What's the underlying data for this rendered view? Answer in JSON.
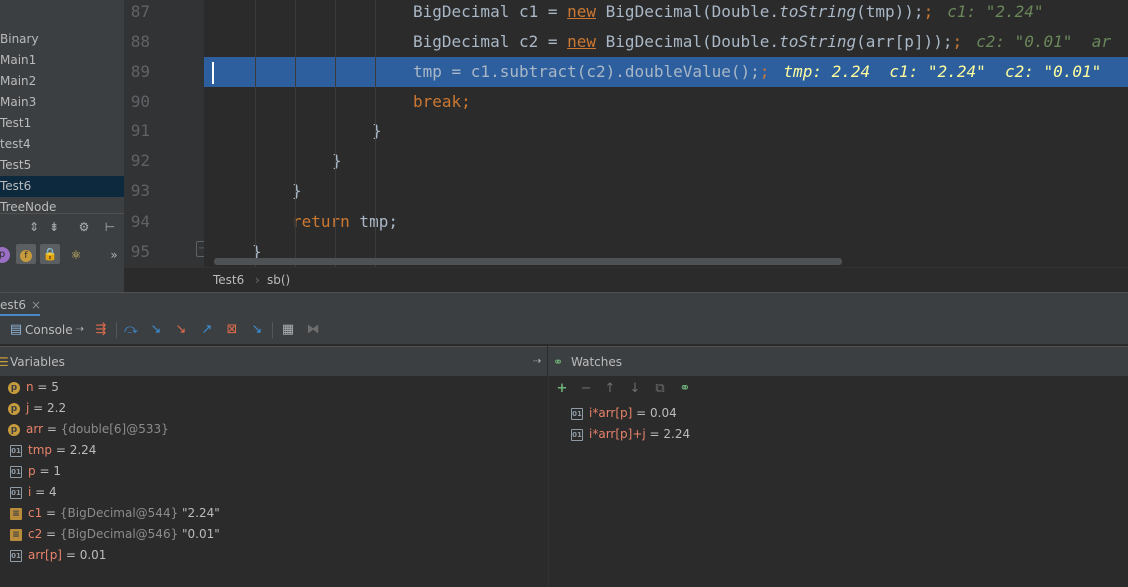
{
  "project_tree": {
    "items": [
      "Binary",
      "Main1",
      "Main2",
      "Main3",
      "Test1",
      "test4",
      "Test5",
      "Test6",
      "TreeNode"
    ],
    "selected": "Test6"
  },
  "editor": {
    "line_numbers": [
      "87",
      "88",
      "89",
      "90",
      "91",
      "92",
      "93",
      "94",
      "95"
    ],
    "highlighted_line": "89",
    "lines": {
      "l87": {
        "a": "BigDecimal c1 = ",
        "b": "new",
        "c": " BigDecimal(Double.",
        "d": "toString",
        "e": "(tmp));",
        "hint": "c1: \"2.24\""
      },
      "l88": {
        "a": "BigDecimal c2 = ",
        "b": "new",
        "c": " BigDecimal(Double.",
        "d": "toString",
        "e": "(arr[p]));",
        "hint": "c2: \"0.01\"  ar"
      },
      "l89": {
        "code": "tmp = c1.subtract(c2).doubleValue();",
        "hint": "tmp: 2.24  c1: \"2.24\"  c2: \"0.01\""
      },
      "l90": {
        "kw": "break",
        "tail": ";"
      },
      "l91": {
        "text": "}"
      },
      "l92": {
        "text": "}"
      },
      "l93": {
        "text": "}"
      },
      "l94": {
        "kw": "return",
        "tail": " tmp;"
      },
      "l95": {
        "text": "}"
      }
    }
  },
  "breadcrumbs": {
    "class": "Test6",
    "method": "sb()"
  },
  "debug": {
    "tab_label": "est6",
    "console_label": "Console",
    "variables_label": "Variables",
    "watches_label": "Watches",
    "variables": [
      {
        "icon": "p",
        "name": "n",
        "eq": " = ",
        "value": "5",
        "type": ""
      },
      {
        "icon": "p",
        "name": "j",
        "eq": " = ",
        "value": "2.2",
        "type": ""
      },
      {
        "icon": "p",
        "name": "arr",
        "eq": " = ",
        "value": "",
        "type": "{double[6]@533}"
      },
      {
        "icon": "oo",
        "name": "tmp",
        "eq": " = ",
        "value": "2.24",
        "type": ""
      },
      {
        "icon": "oo",
        "name": "p",
        "eq": " = ",
        "value": "1",
        "type": ""
      },
      {
        "icon": "oo",
        "name": "i",
        "eq": " = ",
        "value": "4",
        "type": ""
      },
      {
        "icon": "ob",
        "name": "c1",
        "eq": " = ",
        "value": "\"2.24\"",
        "type": "{BigDecimal@544} "
      },
      {
        "icon": "ob",
        "name": "c2",
        "eq": " = ",
        "value": "\"0.01\"",
        "type": "{BigDecimal@546} "
      },
      {
        "icon": "oo",
        "name": "arr[p]",
        "eq": " = ",
        "value": "0.01",
        "type": ""
      }
    ],
    "watches": [
      {
        "name": "i*arr[p]",
        "eq": " = ",
        "value": "0.04"
      },
      {
        "name": "i*arr[p]+j",
        "eq": " = ",
        "value": "2.24"
      }
    ]
  },
  "colors": {
    "editor_bg": "#2b2b2b",
    "highlight_line": "#2d5f9e",
    "keyword": "#cc7832",
    "panel_bg": "#3c3f41",
    "variable_name": "#e8836a"
  }
}
